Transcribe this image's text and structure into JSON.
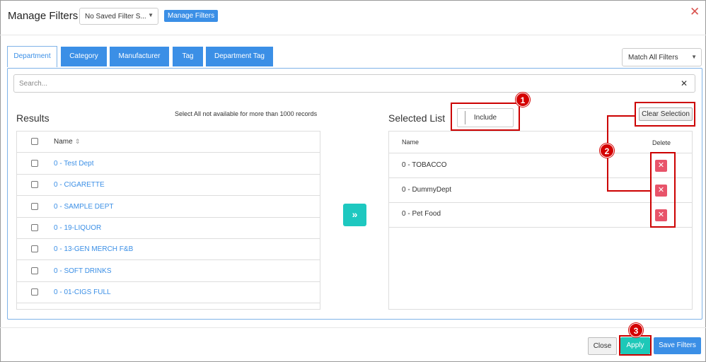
{
  "header": {
    "title": "Manage Filters",
    "saved_filter_value": "No Saved Filter S...",
    "manage_filters_label": "Manage Filters",
    "close_glyph": "✕"
  },
  "tabs": [
    {
      "label": "Department",
      "active": true
    },
    {
      "label": "Category",
      "active": false
    },
    {
      "label": "Manufacturer",
      "active": false
    },
    {
      "label": "Tag",
      "active": false
    },
    {
      "label": "Department Tag",
      "active": false
    }
  ],
  "match_select": {
    "value": "Match All Filters"
  },
  "search": {
    "placeholder": "Search...",
    "value": ""
  },
  "results": {
    "title": "Results",
    "note": "Select All not available for more than 1000 records",
    "column_name": "Name",
    "items": [
      "0 - Test Dept",
      "0 - CIGARETTE",
      "0 - SAMPLE DEPT",
      "0 - 19-LIQUOR",
      "0 - 13-GEN MERCH F&B",
      "0 - SOFT DRINKS",
      "0 - 01-CIGS FULL"
    ]
  },
  "move_glyph": "»",
  "selected": {
    "title": "Selected List",
    "include_label": "Include",
    "clear_label": "Clear Selection",
    "column_name": "Name",
    "column_delete": "Delete",
    "items": [
      "0 - TOBACCO",
      "0 - DummyDept",
      "0 - Pet Food"
    ]
  },
  "annotations": [
    "1",
    "2",
    "3"
  ],
  "footer": {
    "close_label": "Close",
    "apply_label": "Apply",
    "save_label": "Save Filters"
  },
  "colors": {
    "primary": "#3b8fe6",
    "teal": "#1ec8c0",
    "delete": "#e8546a",
    "annotation": "#cc0000"
  }
}
